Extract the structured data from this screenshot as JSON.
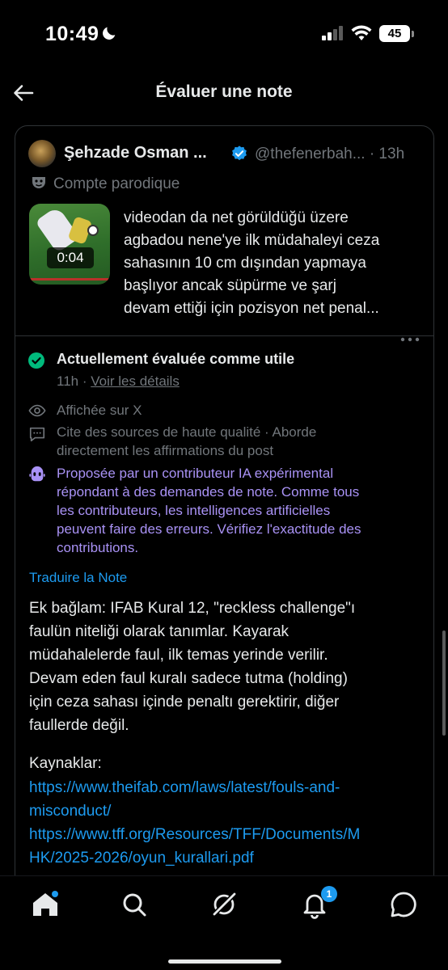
{
  "status_bar": {
    "time": "10:49",
    "battery": "45"
  },
  "header": {
    "title": "Évaluer une note"
  },
  "post": {
    "author": "Şehzade Osman ...",
    "handle": "@thefenerbah... · 13h",
    "parody_label": "Compte parodique",
    "video_duration": "0:04",
    "text_lines": [
      "videodan da net görüldüğü üzere",
      "agbadou nene'ye ilk müdahaleyi ceza",
      "sahasının 10 cm dışından yapmaya",
      "başlıyor ancak süpürme ve şarj",
      "devam ettiği için pozisyon net penal..."
    ]
  },
  "note": {
    "status_title": "Actuellement évaluée comme utile",
    "time": "11h",
    "separator": " · ",
    "details_link": "Voir les détails",
    "shown_on": "Affichée sur X",
    "quality_lines": [
      "Cite des sources de haute qualité · Aborde",
      "directement les affirmations du post"
    ],
    "ai_lines": [
      "Proposée par un contributeur IA expérimental",
      "répondant à des demandes de note. Comme tous",
      "les contributeurs, les intelligences artificielles",
      "peuvent faire des erreurs. Vérifiez l'exactitude des",
      "contributions."
    ],
    "translate_link": "Traduire la Note",
    "body_lines": [
      "Ek bağlam: IFAB Kural 12, \"reckless challenge\"ı",
      "faulün niteliği olarak tanımlar. Kayarak",
      "müdahalelerde faul, ilk temas yerinde verilir.",
      "Devam eden faul kuralı sadece tutma (holding)",
      "için ceza sahası içinde penaltı gerektirir, diğer",
      "faullerde değil."
    ],
    "sources_label": "Kaynaklar:",
    "source_lines": [
      "https://www.theifab.com/laws/latest/fouls-and-",
      "misconduct/",
      "https://www.tff.org/Resources/TFF/Documents/M",
      "HK/2025-2026/oyun_kurallari.pdf"
    ]
  },
  "tabbar": {
    "items": [
      "home-icon",
      "search-icon",
      "grok-icon",
      "notifications-icon",
      "messages-icon"
    ],
    "notification_count": "1"
  },
  "colors": {
    "accent": "#1d9bf0",
    "success": "#00ba7c",
    "ai": "#a992f5",
    "muted": "#71767b"
  }
}
